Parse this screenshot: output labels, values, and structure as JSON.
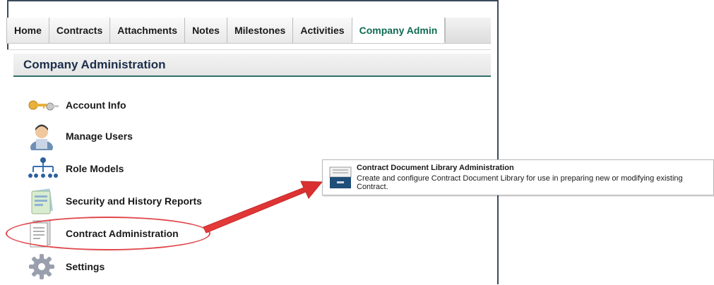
{
  "tabs": [
    {
      "label": "Home"
    },
    {
      "label": "Contracts"
    },
    {
      "label": "Attachments"
    },
    {
      "label": "Notes"
    },
    {
      "label": "Milestones"
    },
    {
      "label": "Activities"
    },
    {
      "label": "Company Admin",
      "active": true
    }
  ],
  "panel": {
    "title": "Company Administration",
    "items": [
      {
        "label": "Account Info",
        "icon": "keys-icon"
      },
      {
        "label": "Manage Users",
        "icon": "user-icon"
      },
      {
        "label": "Role Models",
        "icon": "org-chart-icon"
      },
      {
        "label": "Security and History Reports",
        "icon": "reports-icon"
      },
      {
        "label": "Contract Administration",
        "icon": "document-icon"
      },
      {
        "label": "Settings",
        "icon": "gear-icon"
      }
    ]
  },
  "popup": {
    "title": "Contract Document Library Administration",
    "description": "Create and configure Contract Document Library for use in preparing new or modifying existing Contract.",
    "icon": "file-cabinet-icon"
  },
  "colors": {
    "active_tab_text": "#0f6b52",
    "header_underline": "#2f6f67",
    "annotation_red": "#e0474c"
  }
}
